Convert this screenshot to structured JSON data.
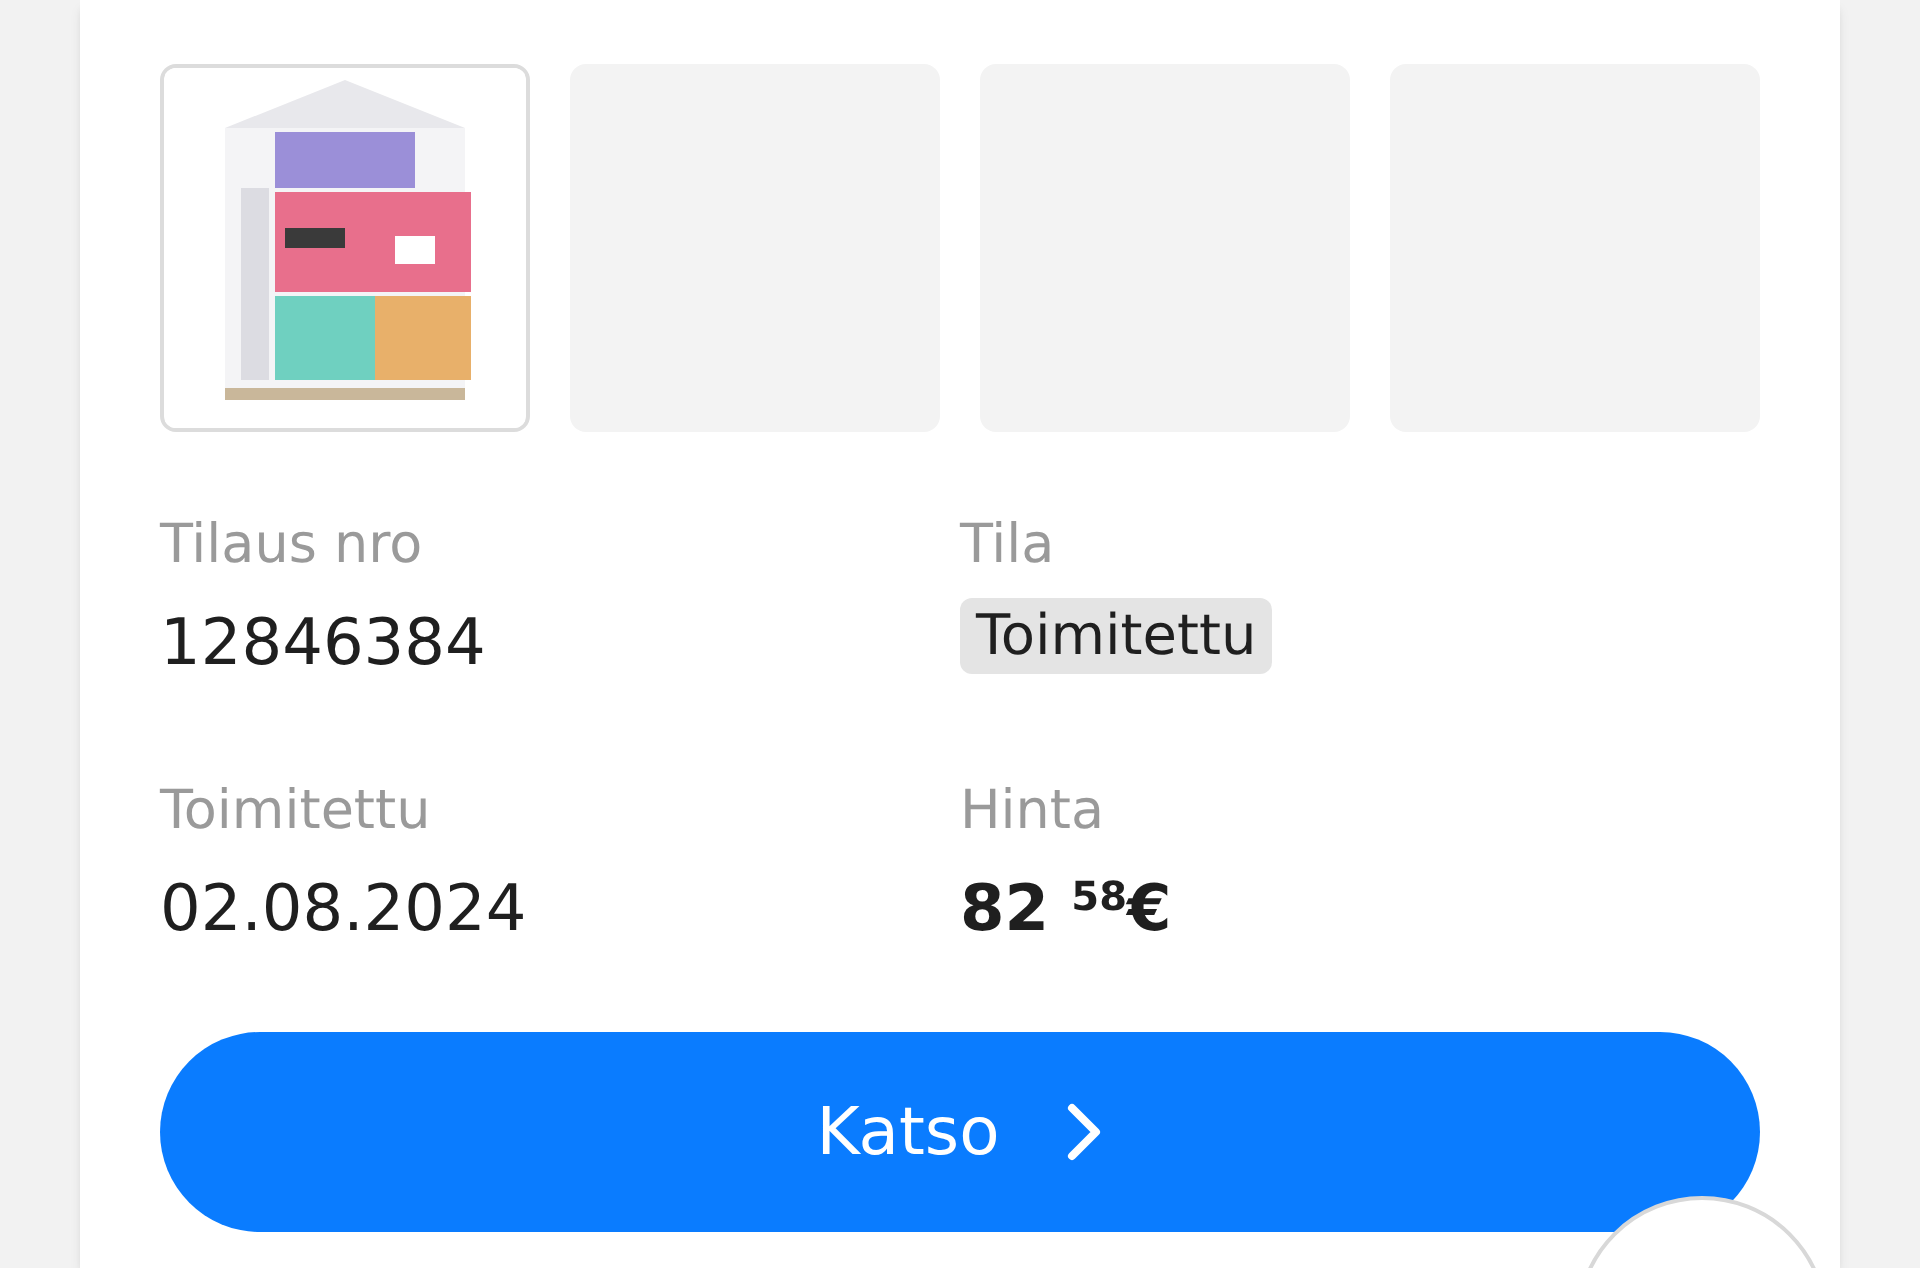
{
  "thumbnails": [
    {
      "kind": "picture"
    },
    {
      "kind": "empty"
    },
    {
      "kind": "empty"
    },
    {
      "kind": "empty"
    }
  ],
  "fields": [
    {
      "label": "Tilaus nro",
      "value": "12846384",
      "kind": "strong"
    },
    {
      "label": "Tila",
      "value": "Toimitettu",
      "kind": "badge"
    },
    {
      "label": "Toimitettu",
      "value": "02.08.2024",
      "kind": "plain"
    },
    {
      "label": "Hinta",
      "value": "82 $^{58}$€",
      "kind": "price"
    }
  ],
  "button": {
    "label": "Katso"
  }
}
